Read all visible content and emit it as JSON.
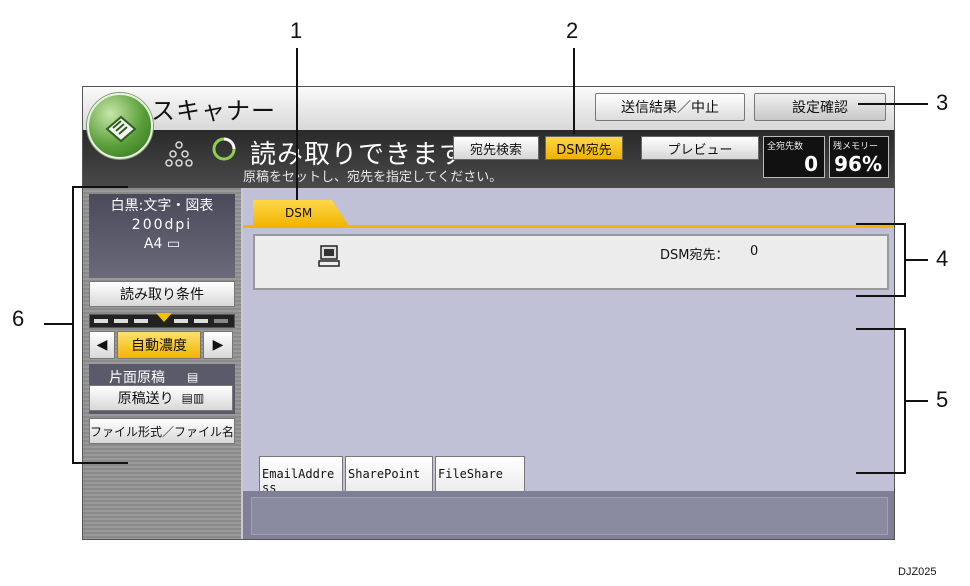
{
  "app": {
    "title": "スキャナー"
  },
  "header": {
    "result_button": "送信結果／中止",
    "check_button": "設定確認"
  },
  "status": {
    "main": "読み取りできます",
    "sub": "原稿をセットし、宛先を指定してください。",
    "addr_search_button": "宛先検索",
    "dsm_dest_button": "DSM宛先",
    "preview_button": "プレビュー",
    "dest_count_label": "全宛先数",
    "dest_count_value": "0",
    "memory_label": "残メモリー",
    "memory_value": "96%"
  },
  "settings": {
    "mode": "白黒:文字・図表",
    "resolution": "200dpi",
    "size": "A4",
    "scan_cond_button": "読み取り条件",
    "auto_density_button": "自動濃度",
    "single_sided": "片面原稿",
    "feed_button": "原稿送り",
    "file_format_button": "ファイル形式／ファイル名"
  },
  "main": {
    "tab": "DSM",
    "dsm_count_label": "DSM宛先：",
    "dsm_count_value": "0",
    "destinations": [
      "EmailAddress",
      "SharePoint",
      "FileShare"
    ]
  },
  "callouts": [
    "1",
    "2",
    "3",
    "4",
    "5",
    "6"
  ],
  "caption": "DJZ025",
  "colors": {
    "accent_yellow": "#f2b400",
    "status_bg": "#333333",
    "panel_bg": "#c0c0d6"
  }
}
